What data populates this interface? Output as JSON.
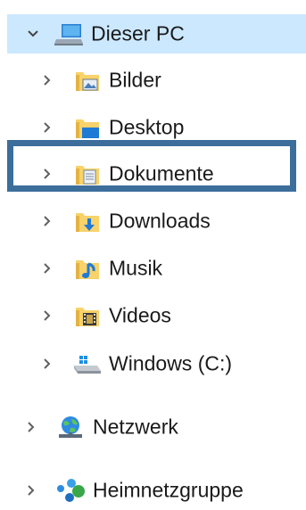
{
  "nav": {
    "this_pc": {
      "label": "Dieser PC",
      "icon": "computer-icon",
      "expanded": true
    },
    "children": [
      {
        "label": "Bilder",
        "icon": "pictures-folder-icon"
      },
      {
        "label": "Desktop",
        "icon": "desktop-folder-icon"
      },
      {
        "label": "Dokumente",
        "icon": "documents-folder-icon",
        "highlighted": true
      },
      {
        "label": "Downloads",
        "icon": "downloads-folder-icon"
      },
      {
        "label": "Musik",
        "icon": "music-folder-icon"
      },
      {
        "label": "Videos",
        "icon": "videos-folder-icon"
      },
      {
        "label": "Windows (C:)",
        "icon": "drive-icon"
      }
    ],
    "network": {
      "label": "Netzwerk",
      "icon": "network-icon"
    },
    "homegroup": {
      "label": "Heimnetzgruppe",
      "icon": "homegroup-icon"
    }
  },
  "colors": {
    "selection_bg": "#cce8ff",
    "highlight_border": "#3c6e9c",
    "folder": "#f8d26a",
    "chevron": "#606060"
  }
}
